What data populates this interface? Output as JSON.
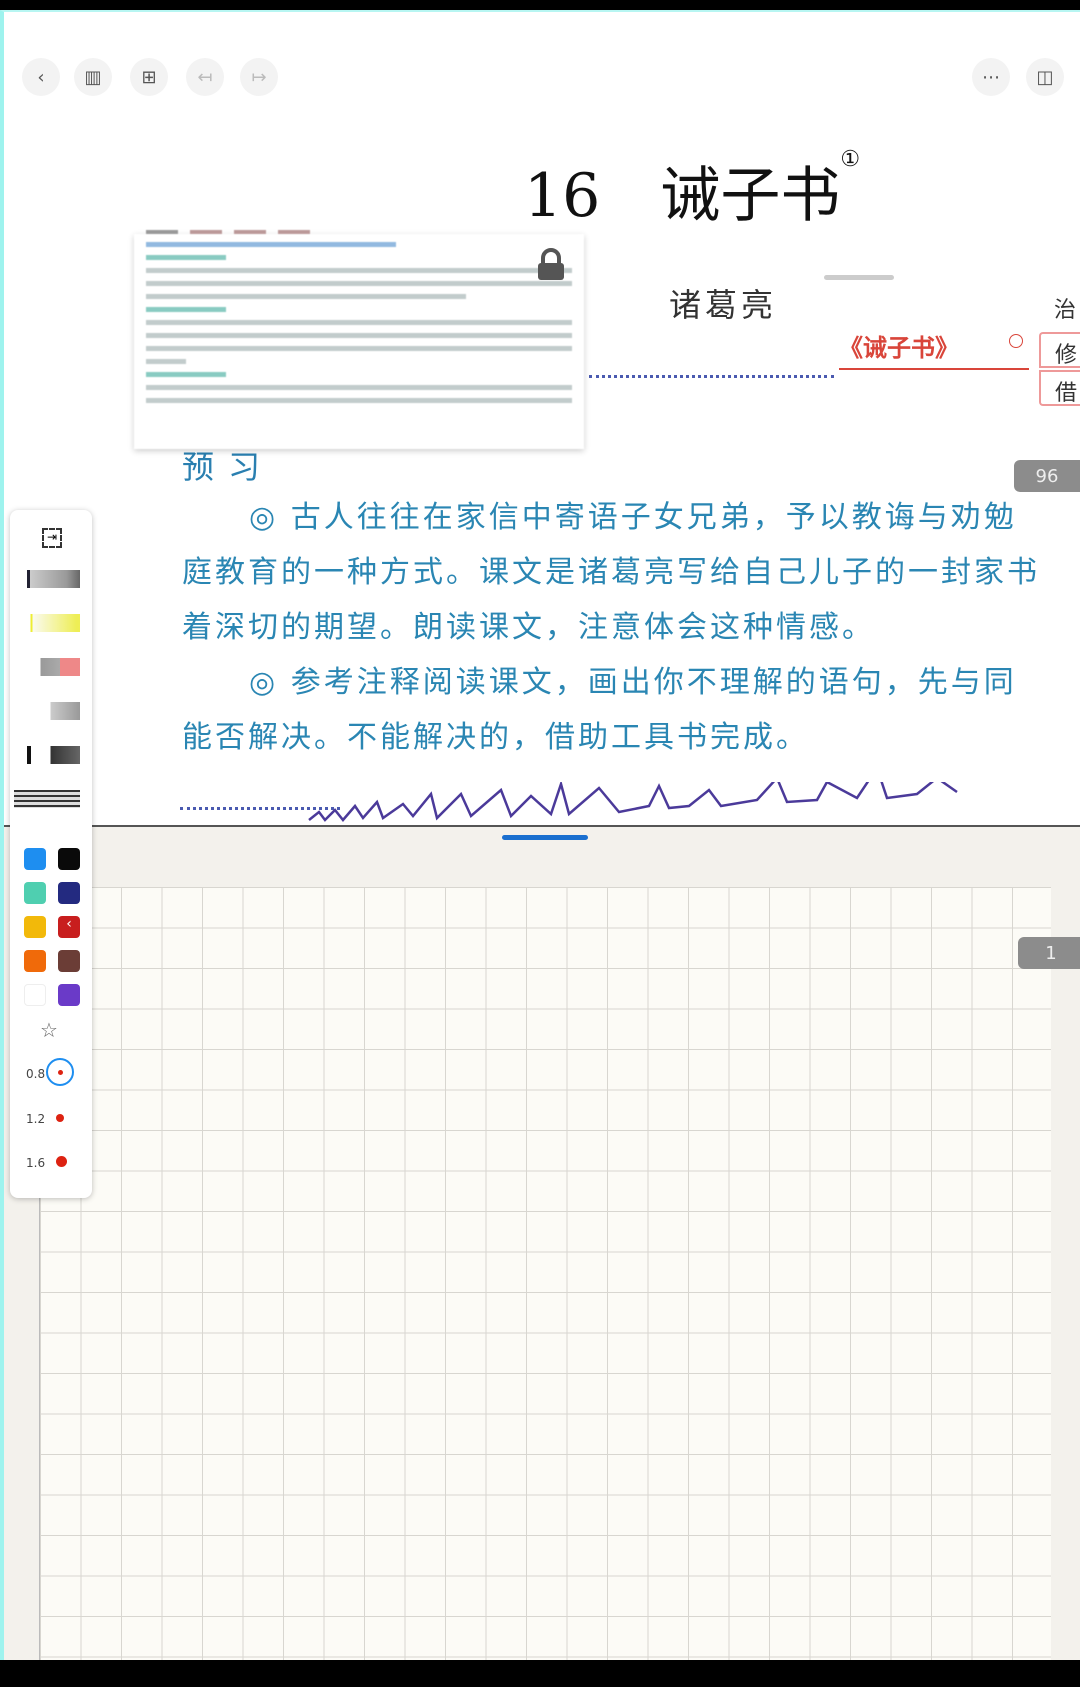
{
  "toolbar_top": {
    "left": [
      "back",
      "sidebar",
      "grid",
      "undo",
      "redo"
    ],
    "right": [
      "more",
      "split-view"
    ]
  },
  "lesson": {
    "number": "16",
    "title": "诫子书",
    "footnote": "①",
    "author": "诸葛亮",
    "section": "预习",
    "paragraphs": [
      "◎  古人往往在家信中寄语子女兄弟，予以教诲与劝勉",
      "庭教育的一种方式。课文是诸葛亮写给自己儿子的一封家书",
      "着深切的期望。朗读课文，注意体会这种情感。",
      "◎  参考注释阅读课文，画出你不理解的语句，先与同",
      "能否解决。不能解决的，借助工具书完成。"
    ]
  },
  "mindmap": {
    "root": "《诫子书》",
    "branches": [
      "治",
      "修",
      "借"
    ],
    "accent": "#d9453a"
  },
  "page_badges": {
    "upper": "96",
    "lower": "1"
  },
  "pen_toolbar": {
    "colors": [
      "#1e8ef0",
      "#0a0a0a",
      "#4fcfb0",
      "#232a80",
      "#f2b90a",
      "#c81e1e",
      "#f06a0a",
      "#6b3d36",
      "#ffffff",
      "#6a3ac8"
    ],
    "sizes": [
      "0.8",
      "1.2",
      "1.6"
    ],
    "selected_size": "0.8"
  }
}
